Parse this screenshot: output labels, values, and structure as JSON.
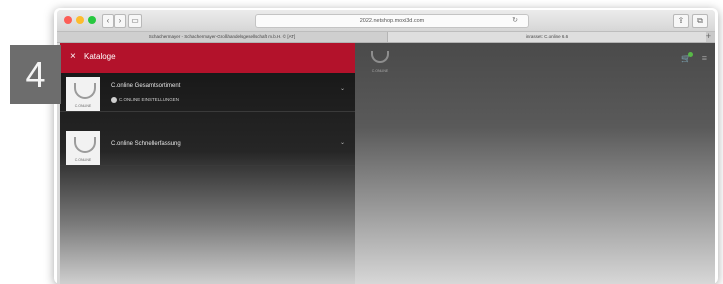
{
  "step": {
    "number": "4"
  },
  "browser": {
    "url": "2022.netshop.moxi3d.com",
    "tabs": [
      "Schachermayer - Schachermayer-Großhandelsgesellschaft m.b.H. © [AT]",
      "inrasset: C.online 6.6"
    ],
    "nav": {
      "back": "‹",
      "forward": "›"
    }
  },
  "panel": {
    "header": {
      "close_icon": "×",
      "title": "Kataloge"
    },
    "items": [
      {
        "title": "C.online Gesamtsortiment",
        "sub": "C.ONLINE EINSTELLUNGEN",
        "thumb_label": "C.ONLINE"
      },
      {
        "title": "C.online Schnellerfassung",
        "thumb_label": "C.ONLINE"
      }
    ]
  },
  "app": {
    "logo_label": "C.ONLINE"
  },
  "icons": {
    "cart": "cart-icon",
    "menu": "menu-icon",
    "chevron": "chevron-down-icon"
  },
  "colors": {
    "accent": "#b3122b",
    "badge": "#58b947"
  }
}
